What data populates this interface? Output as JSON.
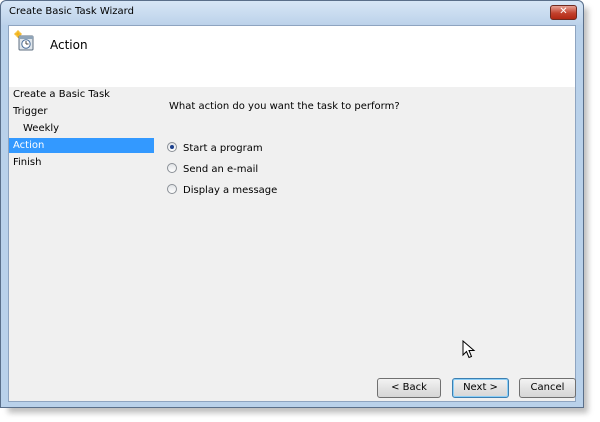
{
  "window": {
    "title": "Create Basic Task Wizard",
    "close_glyph": "✕"
  },
  "header": {
    "title": "Action",
    "icon": "task-scheduler-icon"
  },
  "sidebar": {
    "items": [
      {
        "label": "Create a Basic Task"
      },
      {
        "label": "Trigger"
      },
      {
        "label": "Weekly"
      },
      {
        "label": "Action",
        "selected": true
      },
      {
        "label": "Finish"
      }
    ]
  },
  "main": {
    "question": "What action do you want the task to perform?",
    "options": [
      {
        "label": "Start a program",
        "checked": true
      },
      {
        "label": "Send an e-mail",
        "checked": false
      },
      {
        "label": "Display a message",
        "checked": false
      }
    ]
  },
  "buttons": {
    "back": "< Back",
    "next": "Next >",
    "cancel": "Cancel"
  },
  "colors": {
    "selection": "#3399ff",
    "frame": "#b9d1ea"
  }
}
